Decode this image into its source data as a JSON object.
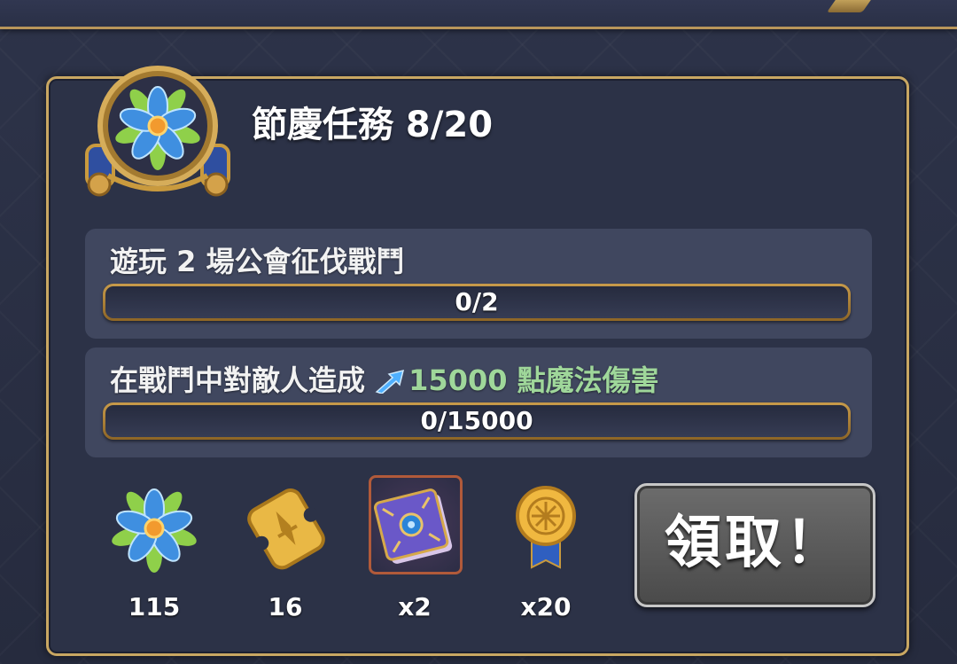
{
  "event": {
    "title": "節慶任務 8/20"
  },
  "tasks": [
    {
      "text": "遊玩 2 場公會征伐戰鬥",
      "progress_text": "0/2",
      "progress_fraction": 0
    },
    {
      "text_prefix": "在戰鬥中對敵人造成 ",
      "highlight": "15000 點魔法傷害",
      "progress_text": "0/15000",
      "progress_fraction": 0
    }
  ],
  "rewards": [
    {
      "icon": "flower-token-icon",
      "count": "115"
    },
    {
      "icon": "gold-ticket-icon",
      "count": "16"
    },
    {
      "icon": "spellbook-icon",
      "count": "x2"
    },
    {
      "icon": "gold-medal-icon",
      "count": "x20"
    }
  ],
  "claim_button": {
    "label": "領取！"
  },
  "colors": {
    "panel_border": "#c9a762",
    "highlight_text": "#9fd79a",
    "claim_button": "#5a5a5a"
  }
}
